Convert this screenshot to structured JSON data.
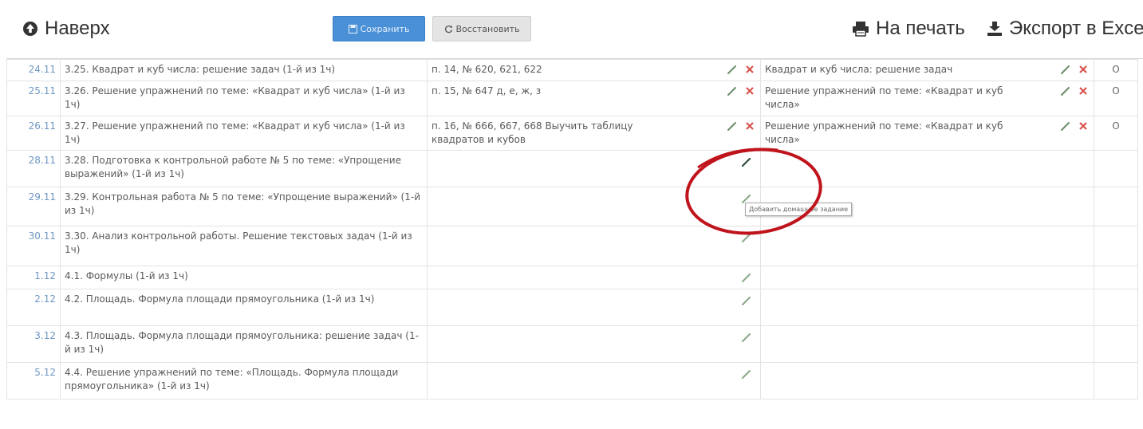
{
  "toolbar": {
    "up_label": "Наверх",
    "save_label": "Сохранить",
    "restore_label": "Восстановить",
    "print_label": "На печать",
    "excel_label": "Экспорт в Excel"
  },
  "rows": [
    {
      "date": "24.11",
      "topic": "3.25. Квадрат и куб числа: решение задач (1-й из 1ч)",
      "homework": "п. 14, № 620, 621, 622",
      "homework2": "Квадрат и куб числа: решение задач",
      "mark": "О"
    },
    {
      "date": "25.11",
      "topic": "3.26. Решение упражнений по теме: «Квадрат и куб числа» (1-й из 1ч)",
      "homework": "п. 15, № 647 д, е, ж, з",
      "homework2": "Решение упражнений по теме: «Квадрат и куб числа»",
      "mark": "О"
    },
    {
      "date": "26.11",
      "topic": "3.27. Решение упражнений по теме: «Квадрат и куб числа» (1-й из 1ч)",
      "homework": "п. 16, № 666, 667, 668 Выучить таблицу квадратов и кубов",
      "homework2": "Решение упражнений по теме: «Квадрат и куб числа»",
      "mark": "О"
    },
    {
      "date": "28.11",
      "topic": "3.28. Подготовка к контрольной работе № 5 по теме: «Упрощение выражений» (1-й из 1ч)",
      "homework": "",
      "homework2": "",
      "mark": ""
    },
    {
      "date": "29.11",
      "topic": "3.29. Контрольная работа № 5 по теме: «Упрощение выражений» (1-й из 1ч)",
      "homework": "",
      "homework2": "",
      "mark": ""
    },
    {
      "date": "30.11",
      "topic": "3.30. Анализ контрольной работы. Решение текстовых задач (1-й из 1ч)",
      "homework": "",
      "homework2": "",
      "mark": ""
    },
    {
      "date": "1.12",
      "topic": "4.1. Формулы (1-й из 1ч)",
      "homework": "",
      "homework2": "",
      "mark": ""
    },
    {
      "date": "2.12",
      "topic": "4.2. Площадь. Формула площади прямоугольника (1-й из 1ч)",
      "homework": "",
      "homework2": "",
      "mark": ""
    },
    {
      "date": "3.12",
      "topic": "4.3. Площадь. Формула площади прямоугольника: решение задач (1-й из 1ч)",
      "homework": "",
      "homework2": "",
      "mark": ""
    },
    {
      "date": "5.12",
      "topic": "4.4. Решение упражнений по теме: «Площадь. Формула площади прямоугольника» (1-й из 1ч)",
      "homework": "",
      "homework2": "",
      "mark": ""
    }
  ],
  "tooltip": {
    "text": "Добавить домашнее задание"
  },
  "colors": {
    "accent": "#4a90d6",
    "delete": "#d9534f",
    "edit": "#6b8e6b",
    "annotation": "#c0141c",
    "date": "#6f97c4"
  }
}
